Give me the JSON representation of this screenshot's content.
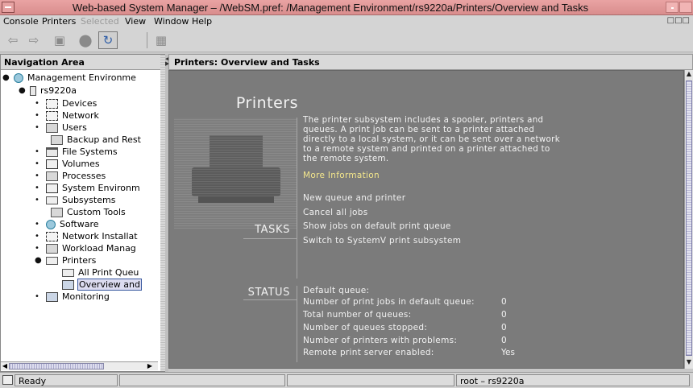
{
  "window": {
    "title": "Web-based System Manager – /WebSM.pref: /Management Environment/rs9220a/Printers/Overview and Tasks"
  },
  "menubar": {
    "items": [
      "Console",
      "Printers",
      "Selected",
      "View",
      "Window",
      "Help"
    ]
  },
  "toolbar": {
    "buttons": [
      {
        "icon": "back-arrow-icon",
        "enabled": false
      },
      {
        "icon": "forward-arrow-icon",
        "enabled": false
      },
      {
        "icon": "up-folder-icon",
        "enabled": false
      },
      {
        "icon": "stop-icon",
        "enabled": false
      },
      {
        "icon": "refresh-icon",
        "enabled": true
      },
      {
        "icon": "find-icon",
        "enabled": false
      }
    ]
  },
  "navigation": {
    "title": "Navigation Area",
    "tree": [
      {
        "label": "Management Environme",
        "level": 0,
        "expanded": true,
        "icon": "management-icon"
      },
      {
        "label": "rs9220a",
        "level": 1,
        "expanded": true,
        "icon": "computer-icon"
      },
      {
        "label": "Devices",
        "level": 2,
        "expanded": false,
        "icon": "devices-icon"
      },
      {
        "label": "Network",
        "level": 2,
        "expanded": false,
        "icon": "network-icon"
      },
      {
        "label": "Users",
        "level": 2,
        "expanded": false,
        "icon": "users-icon"
      },
      {
        "label": "Backup and Rest",
        "level": 3,
        "icon": "backup-icon"
      },
      {
        "label": "File Systems",
        "level": 2,
        "expanded": false,
        "icon": "folder-icon"
      },
      {
        "label": "Volumes",
        "level": 2,
        "expanded": false,
        "icon": "volumes-icon"
      },
      {
        "label": "Processes",
        "level": 2,
        "expanded": false,
        "icon": "processes-icon"
      },
      {
        "label": "System Environm",
        "level": 2,
        "expanded": false,
        "icon": "system-environment-icon"
      },
      {
        "label": "Subsystems",
        "level": 2,
        "expanded": false,
        "icon": "subsystems-icon"
      },
      {
        "label": "Custom Tools",
        "level": 3,
        "icon": "custom-tools-icon"
      },
      {
        "label": "Software",
        "level": 2,
        "expanded": false,
        "icon": "software-icon"
      },
      {
        "label": "Network Installat",
        "level": 2,
        "expanded": false,
        "icon": "network-install-icon"
      },
      {
        "label": "Workload Manag",
        "level": 2,
        "expanded": false,
        "icon": "workload-icon"
      },
      {
        "label": "Printers",
        "level": 2,
        "expanded": true,
        "icon": "printer-icon"
      },
      {
        "label": "All Print Queu",
        "level": 4,
        "icon": "printer-icon"
      },
      {
        "label": "Overview and",
        "level": 4,
        "icon": "overview-icon",
        "selected": true
      },
      {
        "label": "Monitoring",
        "level": 2,
        "expanded": false,
        "icon": "monitoring-icon"
      }
    ]
  },
  "content": {
    "header": "Printers: Overview and Tasks",
    "heading": "Printers",
    "description": "The printer subsystem includes a spooler, printers and queues. A print job can be sent to a printer attached directly to a local system, or it can be sent over a network to a remote system and printed on a printer attached to the remote system.",
    "more_info": "More Information",
    "tasks_label": "TASKS",
    "tasks": [
      "New queue and printer",
      "Cancel all jobs",
      "Show jobs on default print queue",
      "Switch to SystemV print subsystem"
    ],
    "status_label": "STATUS",
    "status": [
      {
        "label": "Default queue:",
        "value": ""
      },
      {
        "label": "Number of print jobs in default queue:",
        "value": "0"
      },
      {
        "label": "Total number of queues:",
        "value": "0"
      },
      {
        "label": "Number of queues stopped:",
        "value": "0"
      },
      {
        "label": "Number of printers with problems:",
        "value": "0"
      },
      {
        "label": "Remote print server enabled:",
        "value": "Yes"
      }
    ]
  },
  "statusbar": {
    "status": "Ready",
    "user_host": "root – rs9220a"
  }
}
